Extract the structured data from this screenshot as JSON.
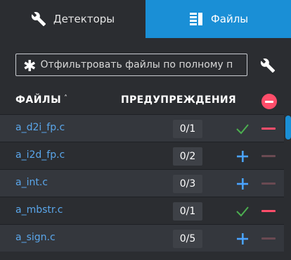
{
  "tabs": {
    "detectors": {
      "label": "Детекторы",
      "icon": "wrench-icon"
    },
    "files": {
      "label": "Файлы",
      "icon": "files-icon",
      "active": true
    }
  },
  "filter": {
    "placeholder": "Отфильтровать файлы по полному п",
    "icon": "asterisk-icon",
    "settings_icon": "wrench-icon"
  },
  "table": {
    "col_files": "ФАЙЛЫ",
    "sort_indicator": "˄",
    "col_warnings": "ПРЕДУПРЕЖДЕНИЯ"
  },
  "rows": [
    {
      "file": "a_d2i_fp.c",
      "warnings": "0/1",
      "mark": "check",
      "minus_active": true
    },
    {
      "file": "a_i2d_fp.c",
      "warnings": "0/2",
      "mark": "plus",
      "minus_active": false
    },
    {
      "file": "a_int.c",
      "warnings": "0/3",
      "mark": "plus",
      "minus_active": false
    },
    {
      "file": "a_mbstr.c",
      "warnings": "0/1",
      "mark": "check",
      "minus_active": true
    },
    {
      "file": "a_sign.c",
      "warnings": "0/5",
      "mark": "plus",
      "minus_active": false
    }
  ],
  "colors": {
    "accent": "#1a8fd6",
    "link": "#5aa6ea",
    "remove": "#ff4d6a",
    "check": "#4caf50"
  }
}
